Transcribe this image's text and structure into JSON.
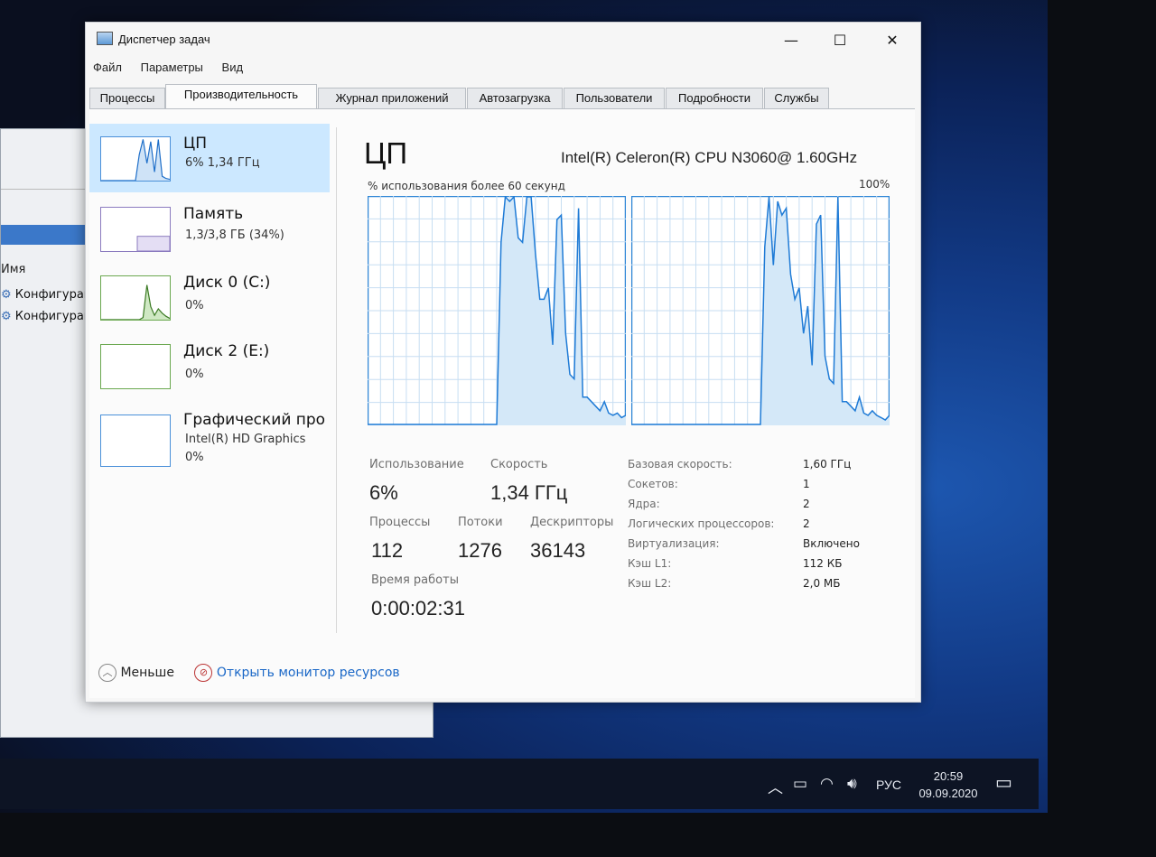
{
  "window": {
    "title": "Диспетчер задач",
    "menu": [
      "Файл",
      "Параметры",
      "Вид"
    ],
    "controls": {
      "minimize": "—",
      "maximize": "☐",
      "close": "✕"
    }
  },
  "tabs": [
    {
      "label": "Процессы"
    },
    {
      "label": "Производительность",
      "active": true
    },
    {
      "label": "Журнал приложений"
    },
    {
      "label": "Автозагрузка"
    },
    {
      "label": "Пользователи"
    },
    {
      "label": "Подробности"
    },
    {
      "label": "Службы"
    }
  ],
  "sidebar": {
    "items": [
      {
        "title": "ЦП",
        "sub1": "6% 1,34 ГГц",
        "sub2": "",
        "selected": true
      },
      {
        "title": "Память",
        "sub1": "1,3/3,8 ГБ (34%)",
        "sub2": ""
      },
      {
        "title": "Диск 0 (C:)",
        "sub1": "0%",
        "sub2": ""
      },
      {
        "title": "Диск 2 (E:)",
        "sub1": "0%",
        "sub2": ""
      },
      {
        "title": "Графический про",
        "sub1": "Intel(R) HD Graphics",
        "sub2": "0%"
      }
    ],
    "memory_used_fraction": 0.34
  },
  "cpu": {
    "title": "ЦП",
    "name": "Intel(R) Celeron(R) CPU N3060@ 1.60GHz",
    "util_label": "% использования более 60 секунд",
    "max_label": "100%",
    "stats": {
      "usage_label": "Использование",
      "usage": "6%",
      "speed_label": "Скорость",
      "speed": "1,34 ГГц",
      "processes_label": "Процессы",
      "processes": "112",
      "threads_label": "Потоки",
      "threads": "1276",
      "handles_label": "Дескрипторы",
      "handles": "36143",
      "uptime_label": "Время работы",
      "uptime": "0:00:02:31"
    },
    "specs": [
      {
        "k": "Базовая скорость:",
        "v": "1,60 ГГц"
      },
      {
        "k": "Сокетов:",
        "v": "1"
      },
      {
        "k": "Ядра:",
        "v": "2"
      },
      {
        "k": "Логических процессоров:",
        "v": "2"
      },
      {
        "k": "Виртуализация:",
        "v": "Включено"
      },
      {
        "k": "Кэш L1:",
        "v": "112 КБ"
      },
      {
        "k": "Кэш L2:",
        "v": "2,0 МБ"
      }
    ]
  },
  "footer": {
    "less": "Меньше",
    "resource_monitor": "Открыть монитор ресурсов"
  },
  "chart_data": {
    "type": "area",
    "ylim": [
      0,
      100
    ],
    "xlim": [
      0,
      60
    ],
    "series": [
      {
        "x": [
          0,
          30,
          31,
          32,
          33,
          34,
          35,
          36,
          37,
          38,
          39,
          40,
          41,
          42,
          43,
          44,
          45,
          46,
          47,
          48,
          49,
          50,
          51,
          52,
          53,
          54,
          55,
          56,
          57,
          58,
          59,
          60
        ],
        "values": [
          0,
          0,
          80,
          100,
          98,
          100,
          82,
          80,
          100,
          100,
          75,
          55,
          55,
          60,
          35,
          90,
          92,
          40,
          22,
          20,
          95,
          12,
          12,
          10,
          8,
          6,
          10,
          5,
          4,
          5,
          3,
          4
        ]
      },
      {
        "x": [
          0,
          30,
          31,
          32,
          33,
          34,
          35,
          36,
          37,
          38,
          39,
          40,
          41,
          42,
          43,
          44,
          45,
          46,
          47,
          48,
          49,
          50,
          51,
          52,
          53,
          54,
          55,
          56,
          57,
          58,
          59,
          60
        ],
        "values": [
          0,
          0,
          78,
          100,
          70,
          98,
          92,
          95,
          66,
          55,
          60,
          40,
          52,
          26,
          88,
          92,
          30,
          20,
          18,
          100,
          10,
          10,
          8,
          6,
          12,
          5,
          4,
          6,
          4,
          3,
          2,
          4
        ]
      }
    ],
    "sidebar_cpu_thumb": [
      0,
      0,
      0,
      0,
      0,
      0,
      0,
      0,
      0,
      0,
      60,
      95,
      40,
      90,
      20,
      95,
      10,
      5,
      3
    ],
    "sidebar_disk_thumb": [
      0,
      0,
      0,
      0,
      0,
      0,
      0,
      0,
      0,
      0,
      0,
      5,
      80,
      30,
      10,
      25,
      15,
      8,
      3
    ]
  },
  "taskbar": {
    "lang": "РУС",
    "time": "20:59",
    "date": "09.09.2020",
    "icons": [
      "chevron-up-icon",
      "battery-icon",
      "wifi-icon",
      "volume-icon",
      "notification-icon"
    ]
  },
  "background_window": {
    "header": "Имя",
    "rows": [
      "Конфигурац",
      "Конфигурац"
    ]
  }
}
